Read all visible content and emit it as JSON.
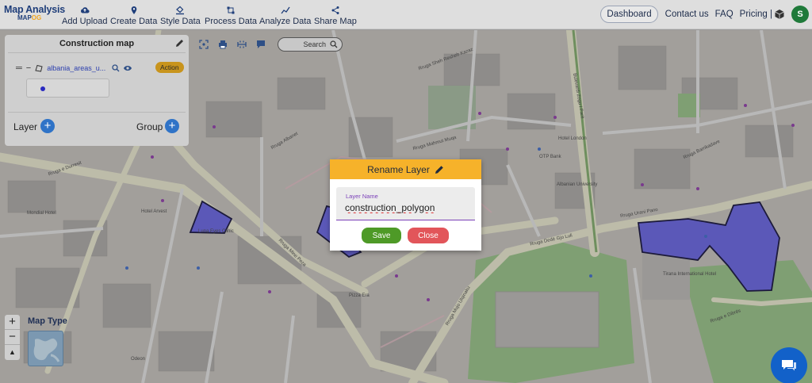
{
  "brand": {
    "title": "Map Analysis",
    "sub_prefix": "MAP",
    "sub_suffix": "OG"
  },
  "nav": [
    {
      "label": "Add Upload",
      "icon": "cloud-upload-icon"
    },
    {
      "label": "Create Data",
      "icon": "map-pin-icon"
    },
    {
      "label": "Style Data",
      "icon": "paint-bucket-icon"
    },
    {
      "label": "Process Data",
      "icon": "process-icon"
    },
    {
      "label": "Analyze Data",
      "icon": "analyze-icon"
    },
    {
      "label": "Share Map",
      "icon": "share-icon"
    }
  ],
  "right_nav": {
    "dashboard": "Dashboard",
    "contact": "Contact us",
    "faq": "FAQ",
    "pricing": "Pricing |",
    "avatar_letter": "S"
  },
  "map_toolbar": {
    "search_label": "Search"
  },
  "panel": {
    "title": "Construction map",
    "layer_name": "albania_areas_u...",
    "action_label": "Action",
    "layer_label": "Layer",
    "group_label": "Group"
  },
  "map_controls": {
    "zoom_in": "+",
    "zoom_out": "−",
    "map_type_label": "Map Type"
  },
  "dialog": {
    "title": "Rename Layer",
    "field_label": "Layer Name",
    "field_value": "construction_polygon",
    "save_label": "Save",
    "close_label": "Close"
  },
  "map_labels": [
    "Rruga Albanet",
    "Rruga e Durresit",
    "Rruga Mine Peza",
    "Rruga Urani Pano",
    "Rruga Dedë Gjo Luli",
    "Rruga e Dibrës",
    "Rruga Mahmut Muqa",
    "Rruga Sheh Resheb Kazaz",
    "Bulevardi Zogu I Parë",
    "Rruga Barrikadave",
    "Rruga Mujo Ulqinaku",
    "Hotel Arvest",
    "Mondial Hotel",
    "Luna Eyes Clinic",
    "Albanian University",
    "Tirana International Hotel",
    "OTP Bank",
    "Hotel London",
    "Pizza Era",
    "Odeon"
  ],
  "colors": {
    "topbar": "#dedede",
    "brand": "#1f3e7a",
    "accent": "#f6b22a",
    "save": "#4e9a27",
    "close": "#e2555a",
    "polygon": "#5b58b8",
    "action": "#c8941d"
  }
}
